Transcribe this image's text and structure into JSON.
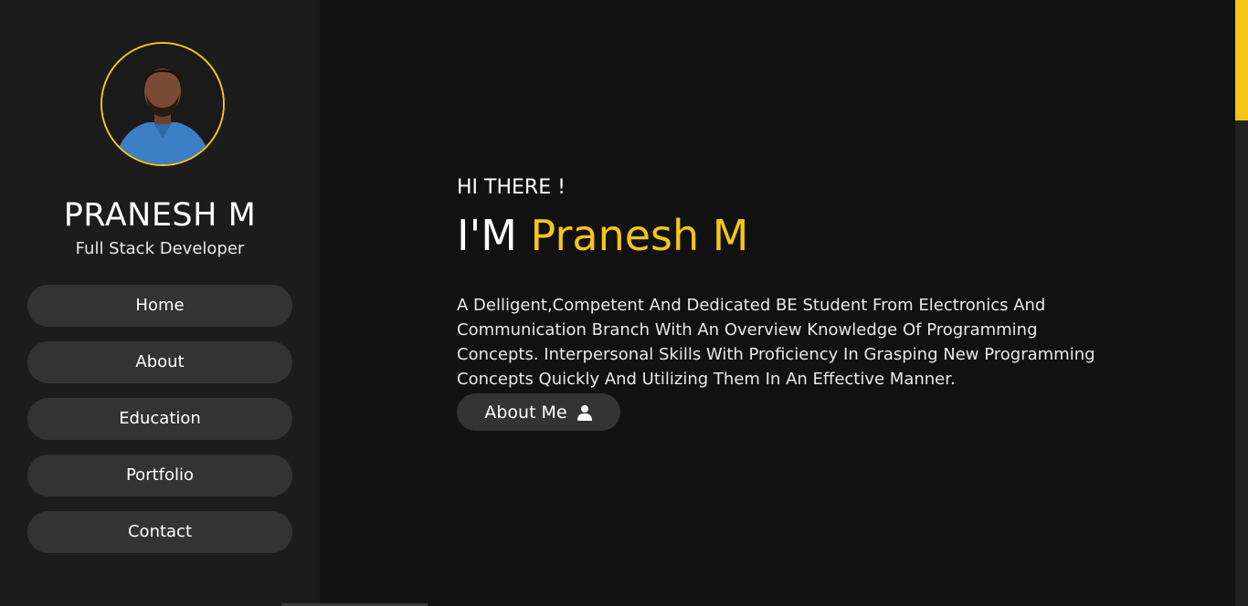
{
  "sidebar": {
    "name": "PRANESH M",
    "role": "Full Stack Developer",
    "nav": [
      {
        "label": "Home"
      },
      {
        "label": "About"
      },
      {
        "label": "Education"
      },
      {
        "label": "Portfolio"
      },
      {
        "label": "Contact"
      }
    ]
  },
  "hero": {
    "greeting": "HI THERE !",
    "headline_prefix": "I'M",
    "headline_name": "Pranesh M",
    "bio": "A Delligent,Competent And Dedicated BE Student From Electronics And Communication Branch With An Overview Knowledge Of Programming Concepts. Interpersonal Skills With Proficiency In Grasping New Programming Concepts Quickly And Utilizing Them In An Effective Manner.",
    "about_button": "About Me",
    "about_button_icon": "user-icon"
  },
  "colors": {
    "accent": "#f5c518",
    "background": "#111111",
    "sidebar": "#1c1c1c",
    "button": "#333333"
  }
}
